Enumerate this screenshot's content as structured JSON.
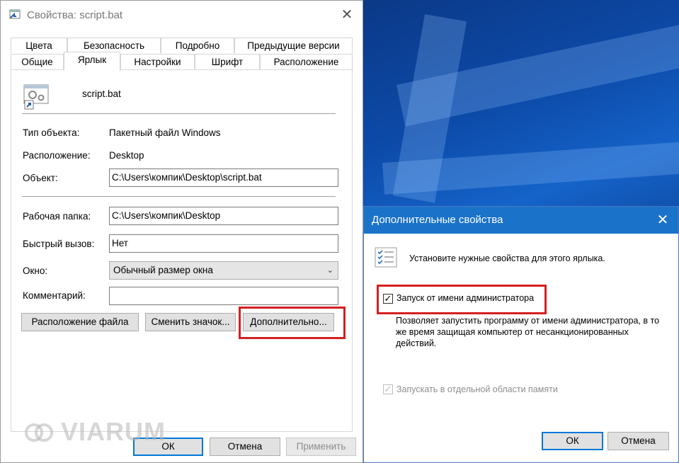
{
  "colors": {
    "accent": "#0078d7",
    "highlight": "#d42020",
    "dialog_title_bg": "#1a73c9"
  },
  "props": {
    "title": "Свойства: script.bat",
    "tabs_row1": [
      "Цвета",
      "Безопасность",
      "Подробно",
      "Предыдущие версии"
    ],
    "tabs_row2": [
      "Общие",
      "Ярлык",
      "Настройки",
      "Шрифт",
      "Расположение"
    ],
    "active_tab": "Ярлык",
    "file_name": "script.bat",
    "type_label": "Тип объекта:",
    "type_value": "Пакетный файл Windows",
    "location_label": "Расположение:",
    "location_value": "Desktop",
    "target_label": "Объект:",
    "target_value": "C:\\Users\\компик\\Desktop\\script.bat",
    "startin_label": "Рабочая папка:",
    "startin_value": "C:\\Users\\компик\\Desktop",
    "hotkey_label": "Быстрый вызов:",
    "hotkey_value": "Нет",
    "run_label": "Окно:",
    "run_value": "Обычный размер окна",
    "comment_label": "Комментарий:",
    "comment_value": "",
    "open_location_btn": "Расположение файла",
    "change_icon_btn": "Сменить значок...",
    "advanced_btn": "Дополнительно...",
    "ok": "ОК",
    "cancel": "Отмена",
    "apply": "Применить"
  },
  "advanced": {
    "title": "Дополнительные свойства",
    "intro": "Установите нужные свойства для этого ярлыка.",
    "run_as_admin": "Запуск от имени администратора",
    "run_as_admin_checked": true,
    "description": "Позволяет запустить программу от имени администратора, в то же время защищая компьютер от несанкционированных действий.",
    "separate_memory": "Запускать в отдельной области памяти",
    "separate_memory_checked": true,
    "ok": "ОК",
    "cancel": "Отмена"
  },
  "watermark": "VIARUM"
}
